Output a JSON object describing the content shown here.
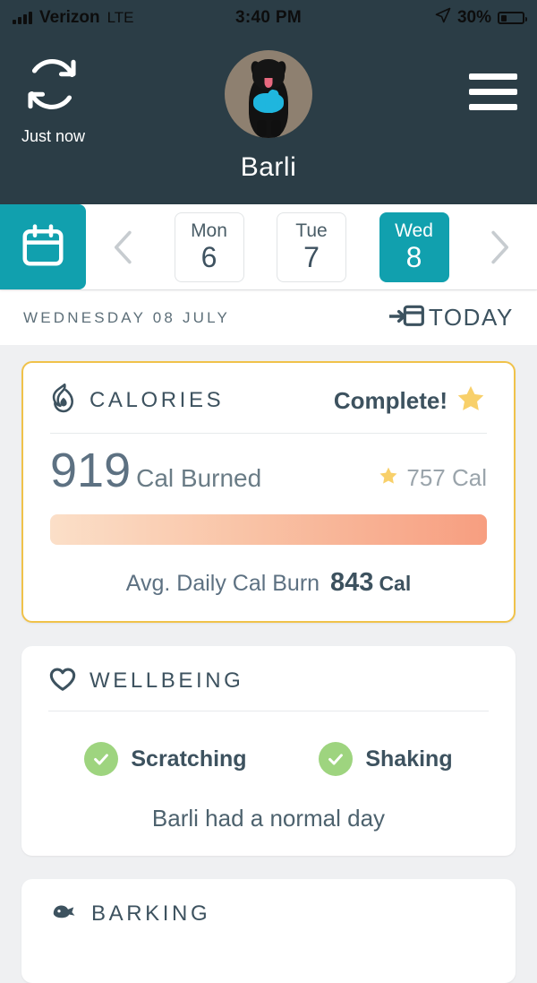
{
  "statusbar": {
    "carrier": "Verizon",
    "network": "LTE",
    "time": "3:40 PM",
    "battery_pct": "30%",
    "signal_icon": "signal-bars-icon",
    "location_icon": "location-arrow-icon",
    "battery_icon": "battery-icon"
  },
  "header": {
    "sync_icon": "sync-refresh-icon",
    "sync_label": "Just now",
    "pet_name": "Barli",
    "avatar_icon": "dog-photo-avatar",
    "menu_icon": "hamburger-menu-icon",
    "bg_color": "#2b3d46"
  },
  "datestrip": {
    "calendar_icon": "calendar-icon",
    "prev_icon": "chevron-left-icon",
    "next_icon": "chevron-right-icon",
    "accent_color": "#11a0ae",
    "days": [
      {
        "dow": "Mon",
        "num": "6",
        "selected": false
      },
      {
        "dow": "Tue",
        "num": "7",
        "selected": false
      },
      {
        "dow": "Wed",
        "num": "8",
        "selected": true
      }
    ]
  },
  "datebar": {
    "date_label": "WEDNESDAY 08 JULY",
    "today_label": "TODAY",
    "today_icon": "jump-to-today-calendar-icon"
  },
  "calories_card": {
    "icon": "flame-icon",
    "title": "CALORIES",
    "status": "Complete!",
    "status_icon": "star-icon",
    "value": "919",
    "unit": "Cal Burned",
    "goal_icon": "star-icon",
    "goal": "757 Cal",
    "progress_pct": 100,
    "avg_label": "Avg. Daily Cal Burn",
    "avg_value": "843",
    "avg_unit": "Cal",
    "border_color": "#f0c24a",
    "bar_gradient_from": "#fbdfc8",
    "bar_gradient_to": "#f79e80"
  },
  "wellbeing_card": {
    "icon": "heart-icon",
    "title": "WELLBEING",
    "checks": [
      {
        "label": "Scratching",
        "icon": "check-circle-icon"
      },
      {
        "label": "Shaking",
        "icon": "check-circle-icon"
      }
    ],
    "summary": "Barli had a normal day",
    "check_color": "#9ed47f"
  },
  "barking_card": {
    "icon": "barking-dog-icon",
    "title": "BARKING"
  }
}
